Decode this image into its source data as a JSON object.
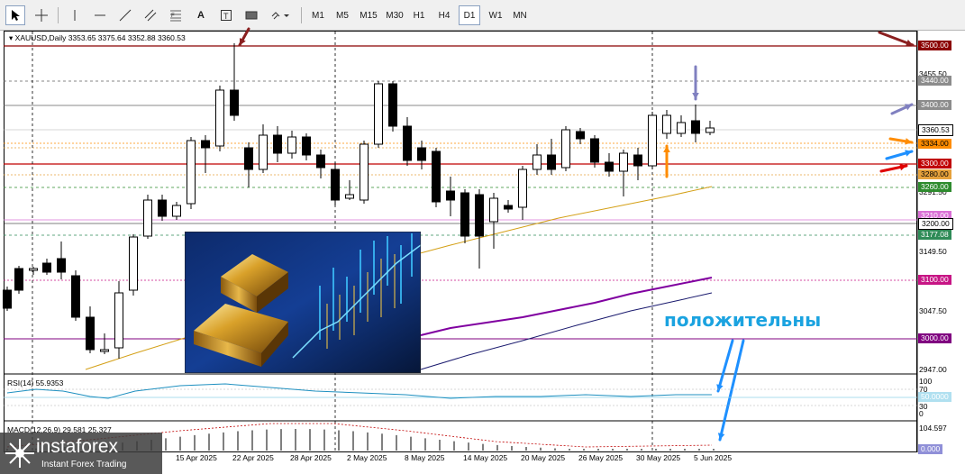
{
  "toolbar": {
    "tools": [
      {
        "name": "cursor-tool",
        "icon": "cursor-icon"
      },
      {
        "name": "crosshair-tool",
        "icon": "crosshair-icon"
      },
      {
        "name": "vertical-line-tool",
        "icon": "vertical-line-icon"
      },
      {
        "name": "horizontal-line-tool",
        "icon": "horizontal-line-icon"
      },
      {
        "name": "trendline-tool",
        "icon": "trendline-icon"
      },
      {
        "name": "channel-tool",
        "icon": "channel-icon"
      },
      {
        "name": "fibonacci-tool",
        "icon": "fibonacci-icon"
      },
      {
        "name": "text-tool",
        "label": "A"
      },
      {
        "name": "text-label-tool",
        "icon": "text-label-icon"
      },
      {
        "name": "rectangle-tool",
        "icon": "rectangle-icon"
      },
      {
        "name": "shapes-menu",
        "icon": "shapes-icon"
      }
    ],
    "timeframes": [
      "M1",
      "M5",
      "M15",
      "M30",
      "H1",
      "H4",
      "D1",
      "W1",
      "MN"
    ],
    "active_timeframe": "D1"
  },
  "chart": {
    "symbol_line": "XAUUSD,Daily  3353.65 3375.64 3352.88 3360.53",
    "price_labels": [
      "3455.50",
      "3291.50",
      "3149.50",
      "3047.50",
      "2947.00"
    ],
    "level_boxes": [
      {
        "text": "3500.00",
        "bg": "#8b0000",
        "fg": "#ffffff"
      },
      {
        "text": "3440.00",
        "bg": "#8c8c8c",
        "fg": "#ffffff"
      },
      {
        "text": "3400.00",
        "bg": "#8c8c8c",
        "fg": "#ffffff"
      },
      {
        "text": "3360.53",
        "bg": "#ffffff",
        "fg": "#000000"
      },
      {
        "text": "3334.00",
        "bg": "#ff8c00",
        "fg": "#000000"
      },
      {
        "text": "3300.00",
        "bg": "#c00000",
        "fg": "#ffffff"
      },
      {
        "text": "3280.00",
        "bg": "#e6a23c",
        "fg": "#000000"
      },
      {
        "text": "3260.00",
        "bg": "#2e8b2e",
        "fg": "#ffffff"
      },
      {
        "text": "3210.00",
        "bg": "#da70d6",
        "fg": "#ffffff"
      },
      {
        "text": "3200.00",
        "bg": "#ffffff",
        "fg": "#000000"
      },
      {
        "text": "3177.08",
        "bg": "#2e8b57",
        "fg": "#ffffff"
      },
      {
        "text": "3100.00",
        "bg": "#c71585",
        "fg": "#ffffff"
      },
      {
        "text": "3000.00",
        "bg": "#800080",
        "fg": "#ffffff"
      }
    ],
    "dates": [
      "15 Apr 2025",
      "22 Apr 2025",
      "28 Apr 2025",
      "2 May 2025",
      "8 May 2025",
      "14 May 2025",
      "20 May 2025",
      "26 May 2025",
      "30 May 2025",
      "5 Jun 2025"
    ],
    "annotation": "положительны",
    "colors": {
      "bull": "#ffffff",
      "bear": "#000000",
      "ma_slow": "#d4a017",
      "ma_purple": "#8000a0",
      "ma_navy": "#1a1a6e"
    }
  },
  "rsi": {
    "label": "RSI(14) 55.9353",
    "scale": [
      "100",
      "70",
      "30",
      "0"
    ],
    "box": "50.0000"
  },
  "macd": {
    "label": "MACD(12,26,9) 29.581 25.327",
    "scale": "104.597",
    "box": "0.000"
  },
  "logo": {
    "name": "instaforex",
    "tagline": "Instant Forex Trading"
  }
}
